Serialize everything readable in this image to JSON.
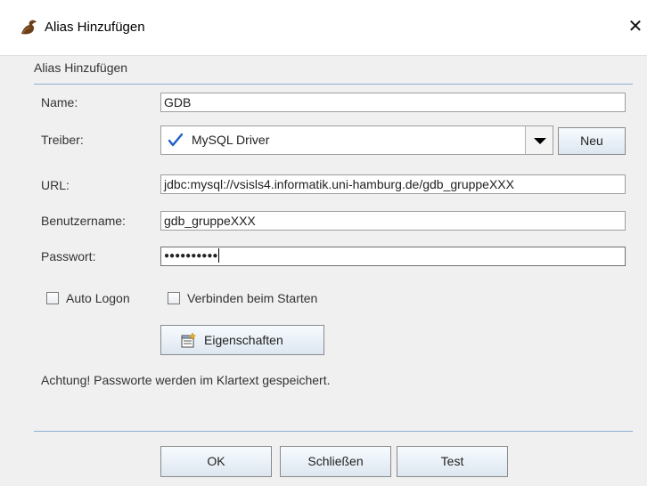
{
  "window": {
    "title": "Alias Hinzufügen",
    "close_glyph": "✕"
  },
  "panel": {
    "title": "Alias Hinzufügen"
  },
  "form": {
    "name_label": "Name:",
    "name_value": "GDB",
    "driver_label": "Treiber:",
    "driver_value": "MySQL Driver",
    "new_driver_button": "Neu",
    "url_label": "URL:",
    "url_value": "jdbc:mysql://vsisls4.informatik.uni-hamburg.de/gdb_gruppeXXX",
    "username_label": "Benutzername:",
    "username_value": "gdb_gruppeXXX",
    "password_label": "Passwort:",
    "password_value": "●●●●●●●●●●"
  },
  "options": {
    "auto_logon": {
      "label": "Auto Logon",
      "checked": false
    },
    "connect_on_start": {
      "label": "Verbinden beim Starten",
      "checked": false
    }
  },
  "properties_button": "Eigenschaften",
  "warning": "Achtung! Passworte werden im Klartext gespeichert.",
  "buttons": {
    "ok": "OK",
    "close": "Schließen",
    "test": "Test"
  },
  "icons": {
    "app": "squirrel-icon",
    "driver_ok": "checkmark-icon",
    "properties": "properties-icon",
    "close": "close-icon"
  },
  "colors": {
    "separator": "#8ab0d6",
    "checkmark": "#1e5fc8",
    "background": "#f0f0f0"
  }
}
